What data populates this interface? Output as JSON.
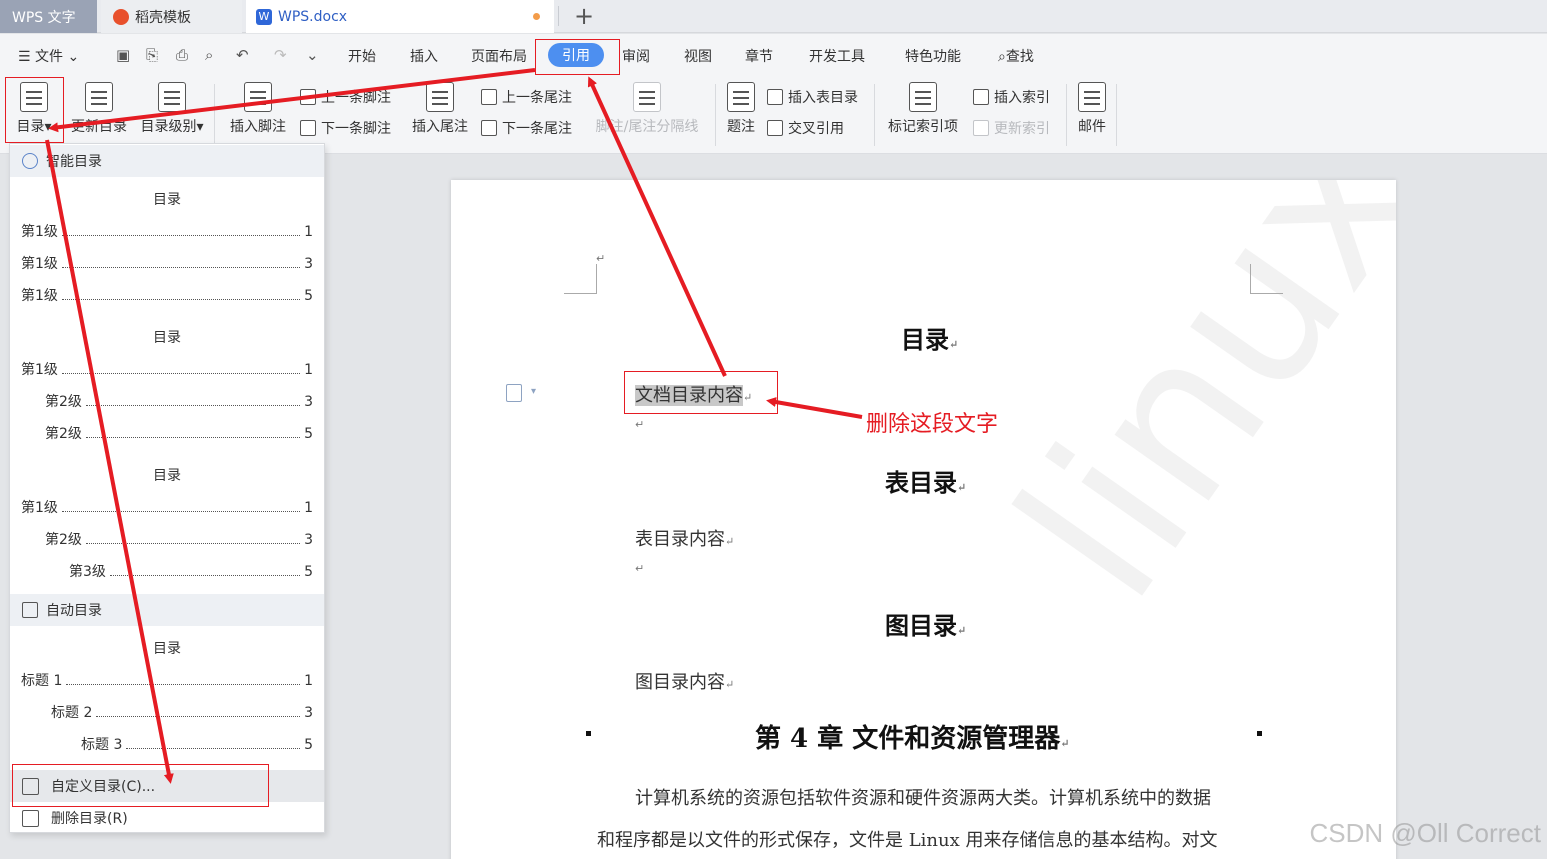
{
  "tabs": [
    {
      "label": "WPS 文字"
    },
    {
      "label": "稻壳模板"
    },
    {
      "label": "WPS.docx"
    }
  ],
  "menu": {
    "file": "文件",
    "items": [
      "开始",
      "插入",
      "页面布局",
      "引用",
      "审阅",
      "视图",
      "章节",
      "开发工具",
      "特色功能"
    ],
    "search": "查找"
  },
  "ribbon": {
    "toc": "目录",
    "update_toc": "更新目录",
    "toc_level": "目录级别",
    "insert_footnote": "插入脚注",
    "prev_footnote": "上一条脚注",
    "next_footnote": "下一条脚注",
    "insert_endnote": "插入尾注",
    "prev_endnote": "上一条尾注",
    "next_endnote": "下一条尾注",
    "separator": "脚注/尾注分隔线",
    "caption": "题注",
    "insert_table_toc": "插入表目录",
    "cross_ref": "交叉引用",
    "mark_index": "标记索引项",
    "insert_index": "插入索引",
    "update_index": "更新索引",
    "mail": "邮件"
  },
  "dropdown": {
    "smart_toc": "智能目录",
    "auto_toc": "自动目录",
    "preview_title": "目录",
    "preview1": [
      {
        "label": "第1级",
        "page": "1"
      },
      {
        "label": "第1级",
        "page": "3"
      },
      {
        "label": "第1级",
        "page": "5"
      }
    ],
    "preview2": [
      {
        "label": "第1级",
        "page": "1"
      },
      {
        "label": "第2级",
        "page": "3"
      },
      {
        "label": "第2级",
        "page": "5"
      }
    ],
    "preview3": [
      {
        "label": "第1级",
        "page": "1"
      },
      {
        "label": "第2级",
        "page": "3"
      },
      {
        "label": "第3级",
        "page": "5"
      }
    ],
    "preview4": [
      {
        "label": "标题 1",
        "page": "1"
      },
      {
        "label": "标题 2",
        "page": "3"
      },
      {
        "label": "标题 3",
        "page": "5"
      }
    ],
    "custom": "自定义目录(C)...",
    "delete": "删除目录(R)"
  },
  "document": {
    "toc_title": "目录",
    "toc_content": "文档目录内容",
    "table_toc_title": "表目录",
    "table_toc_content": "表目录内容",
    "figure_toc_title": "图目录",
    "figure_toc_content": "图目录内容",
    "chapter_title": "第 4 章 文件和资源管理器",
    "para1": "计算机系统的资源包括软件资源和硬件资源两大类。计算机系统中的数据",
    "para2": "和程序都是以文件的形式保存，文件是 Linux 用来存储信息的基本结构。对文",
    "watermark": "linux"
  },
  "annotation": "删除这段文字",
  "footer_watermark": "CSDN @Oll Correct"
}
